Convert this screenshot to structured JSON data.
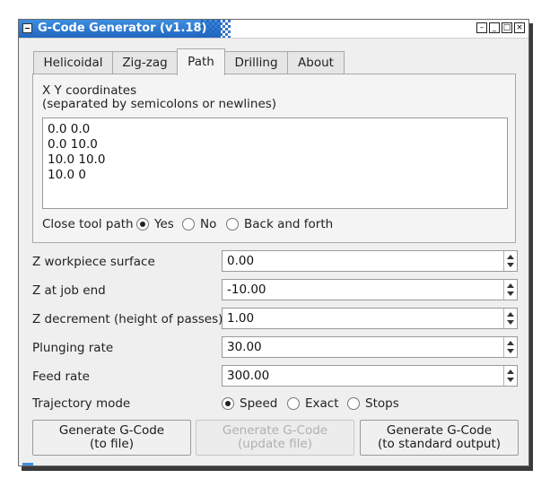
{
  "window": {
    "title": "G-Code Generator (v1.18)",
    "buttons": [
      "–",
      "_",
      "□",
      "×"
    ]
  },
  "tabs": [
    {
      "label": "Helicoidal",
      "active": false
    },
    {
      "label": "Zig-zag",
      "active": false
    },
    {
      "label": "Path",
      "active": true
    },
    {
      "label": "Drilling",
      "active": false
    },
    {
      "label": "About",
      "active": false
    }
  ],
  "path": {
    "coords_label_line1": "X Y coordinates",
    "coords_label_line2": "(separated by semicolons or newlines)",
    "coords": [
      "0.0 0.0",
      "0.0 10.0",
      "10.0 10.0",
      "10.0 0"
    ],
    "close_label": "Close tool path",
    "close_options": [
      {
        "label": "Yes",
        "checked": true
      },
      {
        "label": "No",
        "checked": false
      },
      {
        "label": "Back and forth",
        "checked": false
      }
    ]
  },
  "fields": [
    {
      "label": "Z workpiece surface",
      "value": "0.00"
    },
    {
      "label": "Z at job end",
      "value": "-10.00"
    },
    {
      "label": "Z decrement (height of passes)",
      "value": "1.00"
    },
    {
      "label": "Plunging rate",
      "value": "30.00"
    },
    {
      "label": "Feed rate",
      "value": "300.00"
    }
  ],
  "trajectory": {
    "label": "Trajectory mode",
    "options": [
      {
        "label": "Speed",
        "checked": true
      },
      {
        "label": "Exact",
        "checked": false
      },
      {
        "label": "Stops",
        "checked": false
      }
    ]
  },
  "actions": [
    {
      "line1": "Generate G-Code",
      "line2": "(to file)",
      "enabled": true
    },
    {
      "line1": "Generate G-Code",
      "line2": "(update file)",
      "enabled": false
    },
    {
      "line1": "Generate G-Code",
      "line2": "(to standard output)",
      "enabled": true
    }
  ],
  "colors": {
    "titlebar": "#2266c0",
    "window_bg": "#efefef"
  }
}
